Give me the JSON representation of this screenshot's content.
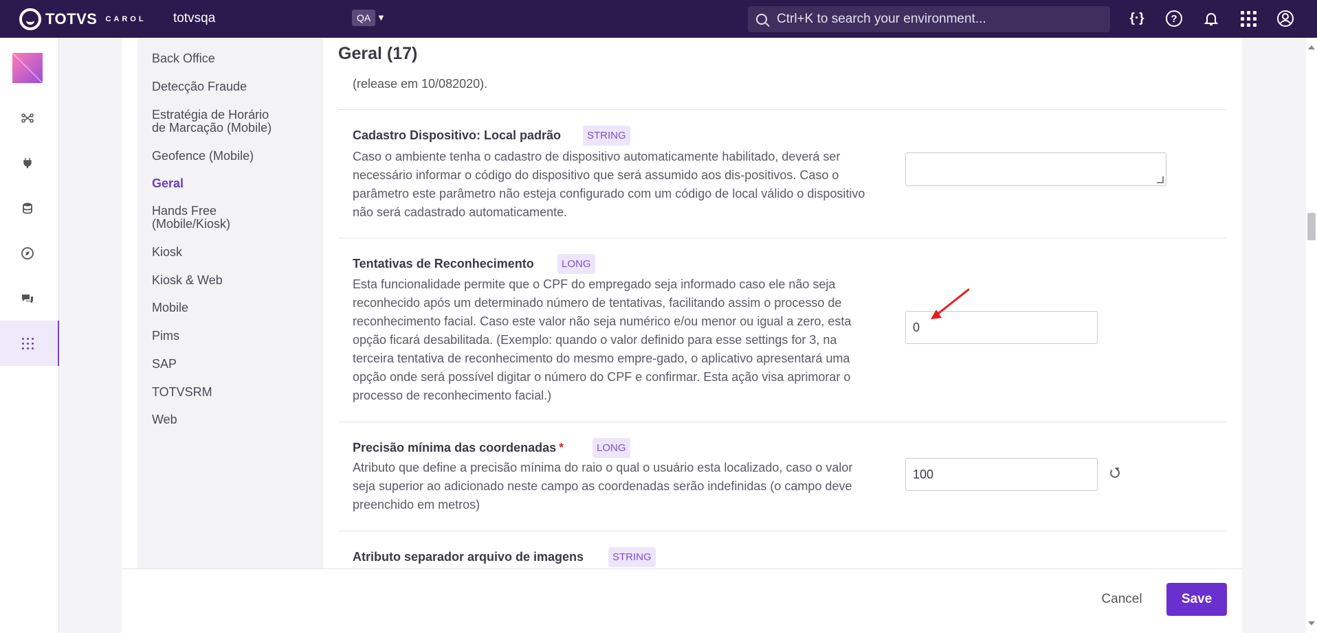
{
  "topbar": {
    "brand": "TOTVS",
    "brand_sub": "CAROL",
    "env_name": "totvsqa",
    "env_badge": "QA",
    "search_placeholder": "Ctrl+K to search your environment..."
  },
  "sidebar": {
    "items": [
      {
        "label": "Back Office"
      },
      {
        "label": "Detecção Fraude"
      },
      {
        "label": "Estratégia de Horário\nde Marcação (Mobile)"
      },
      {
        "label": "Geofence (Mobile)"
      },
      {
        "label": "Geral"
      },
      {
        "label": "Hands Free\n(Mobile/Kiosk)"
      },
      {
        "label": "Kiosk"
      },
      {
        "label": "Kiosk & Web"
      },
      {
        "label": "Mobile"
      },
      {
        "label": "Pims"
      },
      {
        "label": "SAP"
      },
      {
        "label": "TOTVSRM"
      },
      {
        "label": "Web"
      }
    ],
    "active": "Geral"
  },
  "main": {
    "title": "Geral (17)",
    "clipped_text": "(release em 10/082020).",
    "settings": [
      {
        "title": "Cadastro Dispositivo: Local padrão",
        "type": "STRING",
        "description": "Caso o ambiente tenha o cadastro de dispositivo automaticamente habilitado, deverá ser necessário informar o código do dispositivo que será assumido aos dis-positivos. Caso o parâmetro este parâmetro não esteja configurado com um código de local válido o dispositivo não será cadastrado automaticamente.",
        "value": ""
      },
      {
        "title": "Tentativas de Reconhecimento",
        "type": "LONG",
        "description": "Esta funcionalidade permite que o CPF do empregado seja informado caso ele não seja reconhecido após um determinado número de tentativas, facilitando assim o processo de reconhecimento facial. Caso este valor não seja numérico e/ou menor ou igual a zero, esta opção ficará desabilitada. (Exemplo: quando o valor definido para esse settings for 3, na terceira tentativa de reconhecimento do mesmo empre-gado, o aplicativo apresentará uma opção onde será possível digitar o número do CPF e confirmar. Esta ação visa aprimorar o processo de reconhecimento facial.)",
        "value": "0"
      },
      {
        "title": "Precisão mínima das coordenadas",
        "required_mark": "*",
        "type": "LONG",
        "description": "Atributo que define a precisão mínima do raio o qual o usuário esta localizado, caso o valor seja superior ao adicionado neste campo as coordenadas serão indefinidas (o campo deve preenchido em metros)",
        "value": "100"
      },
      {
        "title": "Atributo separador arquivo de imagens",
        "type": "STRING"
      }
    ]
  },
  "footer": {
    "cancel_label": "Cancel",
    "save_label": "Save"
  },
  "colors": {
    "topbar": "#2b1a4d",
    "accent": "#6a2fcf",
    "annotation_arrow": "#e02020"
  }
}
